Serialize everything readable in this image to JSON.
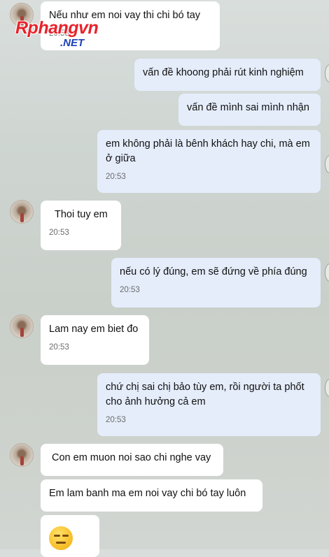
{
  "watermark": {
    "brand": "Rphangvn",
    "suffix": ".NET"
  },
  "messages": [
    {
      "text": "Nếu như em noi vay   thi chi bó tay",
      "time": "20:53"
    },
    {
      "text": "vấn đề khoong phải rút kinh nghiệm"
    },
    {
      "text": "vấn đề mình sai mình nhận"
    },
    {
      "text": "em không phải là bênh khách hay chi, mà em ở giữa",
      "time": "20:53"
    },
    {
      "text": "Thoi tuy em",
      "time": "20:53"
    },
    {
      "text": "nếu có lý đúng, em sẽ đứng về phía đúng",
      "time": "20:53"
    },
    {
      "text": "Lam nay em biet đo",
      "time": "20:53"
    },
    {
      "text": "chứ chị sai chị bảo tùy em, rồi người ta phốt cho ảnh hưởng cả em",
      "time": "20:53"
    },
    {
      "text": "Con em muon noi sao chi nghe vay"
    },
    {
      "text": "Em lam banh ma em noi vay chi bó tay luôn"
    }
  ],
  "sticker": {
    "icon": "neutral-face-emoji-icon"
  },
  "colors": {
    "sent_bubble": "#e5edfb",
    "received_bubble": "#ffffff",
    "watermark_red": "#e8222b",
    "watermark_blue": "#1a3fb8"
  }
}
